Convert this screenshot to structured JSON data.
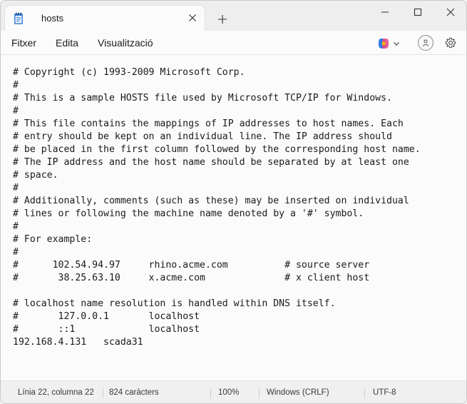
{
  "tab": {
    "title": "hosts"
  },
  "menu": {
    "file": "Fitxer",
    "edit": "Edita",
    "view": "Visualització"
  },
  "editor": {
    "lines": [
      "# Copyright (c) 1993-2009 Microsoft Corp.",
      "#",
      "# This is a sample HOSTS file used by Microsoft TCP/IP for Windows.",
      "#",
      "# This file contains the mappings of IP addresses to host names. Each",
      "# entry should be kept on an individual line. The IP address should",
      "# be placed in the first column followed by the corresponding host name.",
      "# The IP address and the host name should be separated by at least one",
      "# space.",
      "#",
      "# Additionally, comments (such as these) may be inserted on individual",
      "# lines or following the machine name denoted by a '#' symbol.",
      "#",
      "# For example:",
      "#",
      "#      102.54.94.97     rhino.acme.com          # source server",
      "#       38.25.63.10     x.acme.com              # x client host",
      "",
      "# localhost name resolution is handled within DNS itself.",
      "#\t127.0.0.1       localhost",
      "#\t::1             localhost",
      "192.168.4.131   scada31"
    ]
  },
  "status": {
    "position": "Línia 22, columna 22",
    "chars": "824 caràcters",
    "zoom": "100%",
    "line_ending": "Windows (CRLF)",
    "encoding": "UTF-8"
  }
}
